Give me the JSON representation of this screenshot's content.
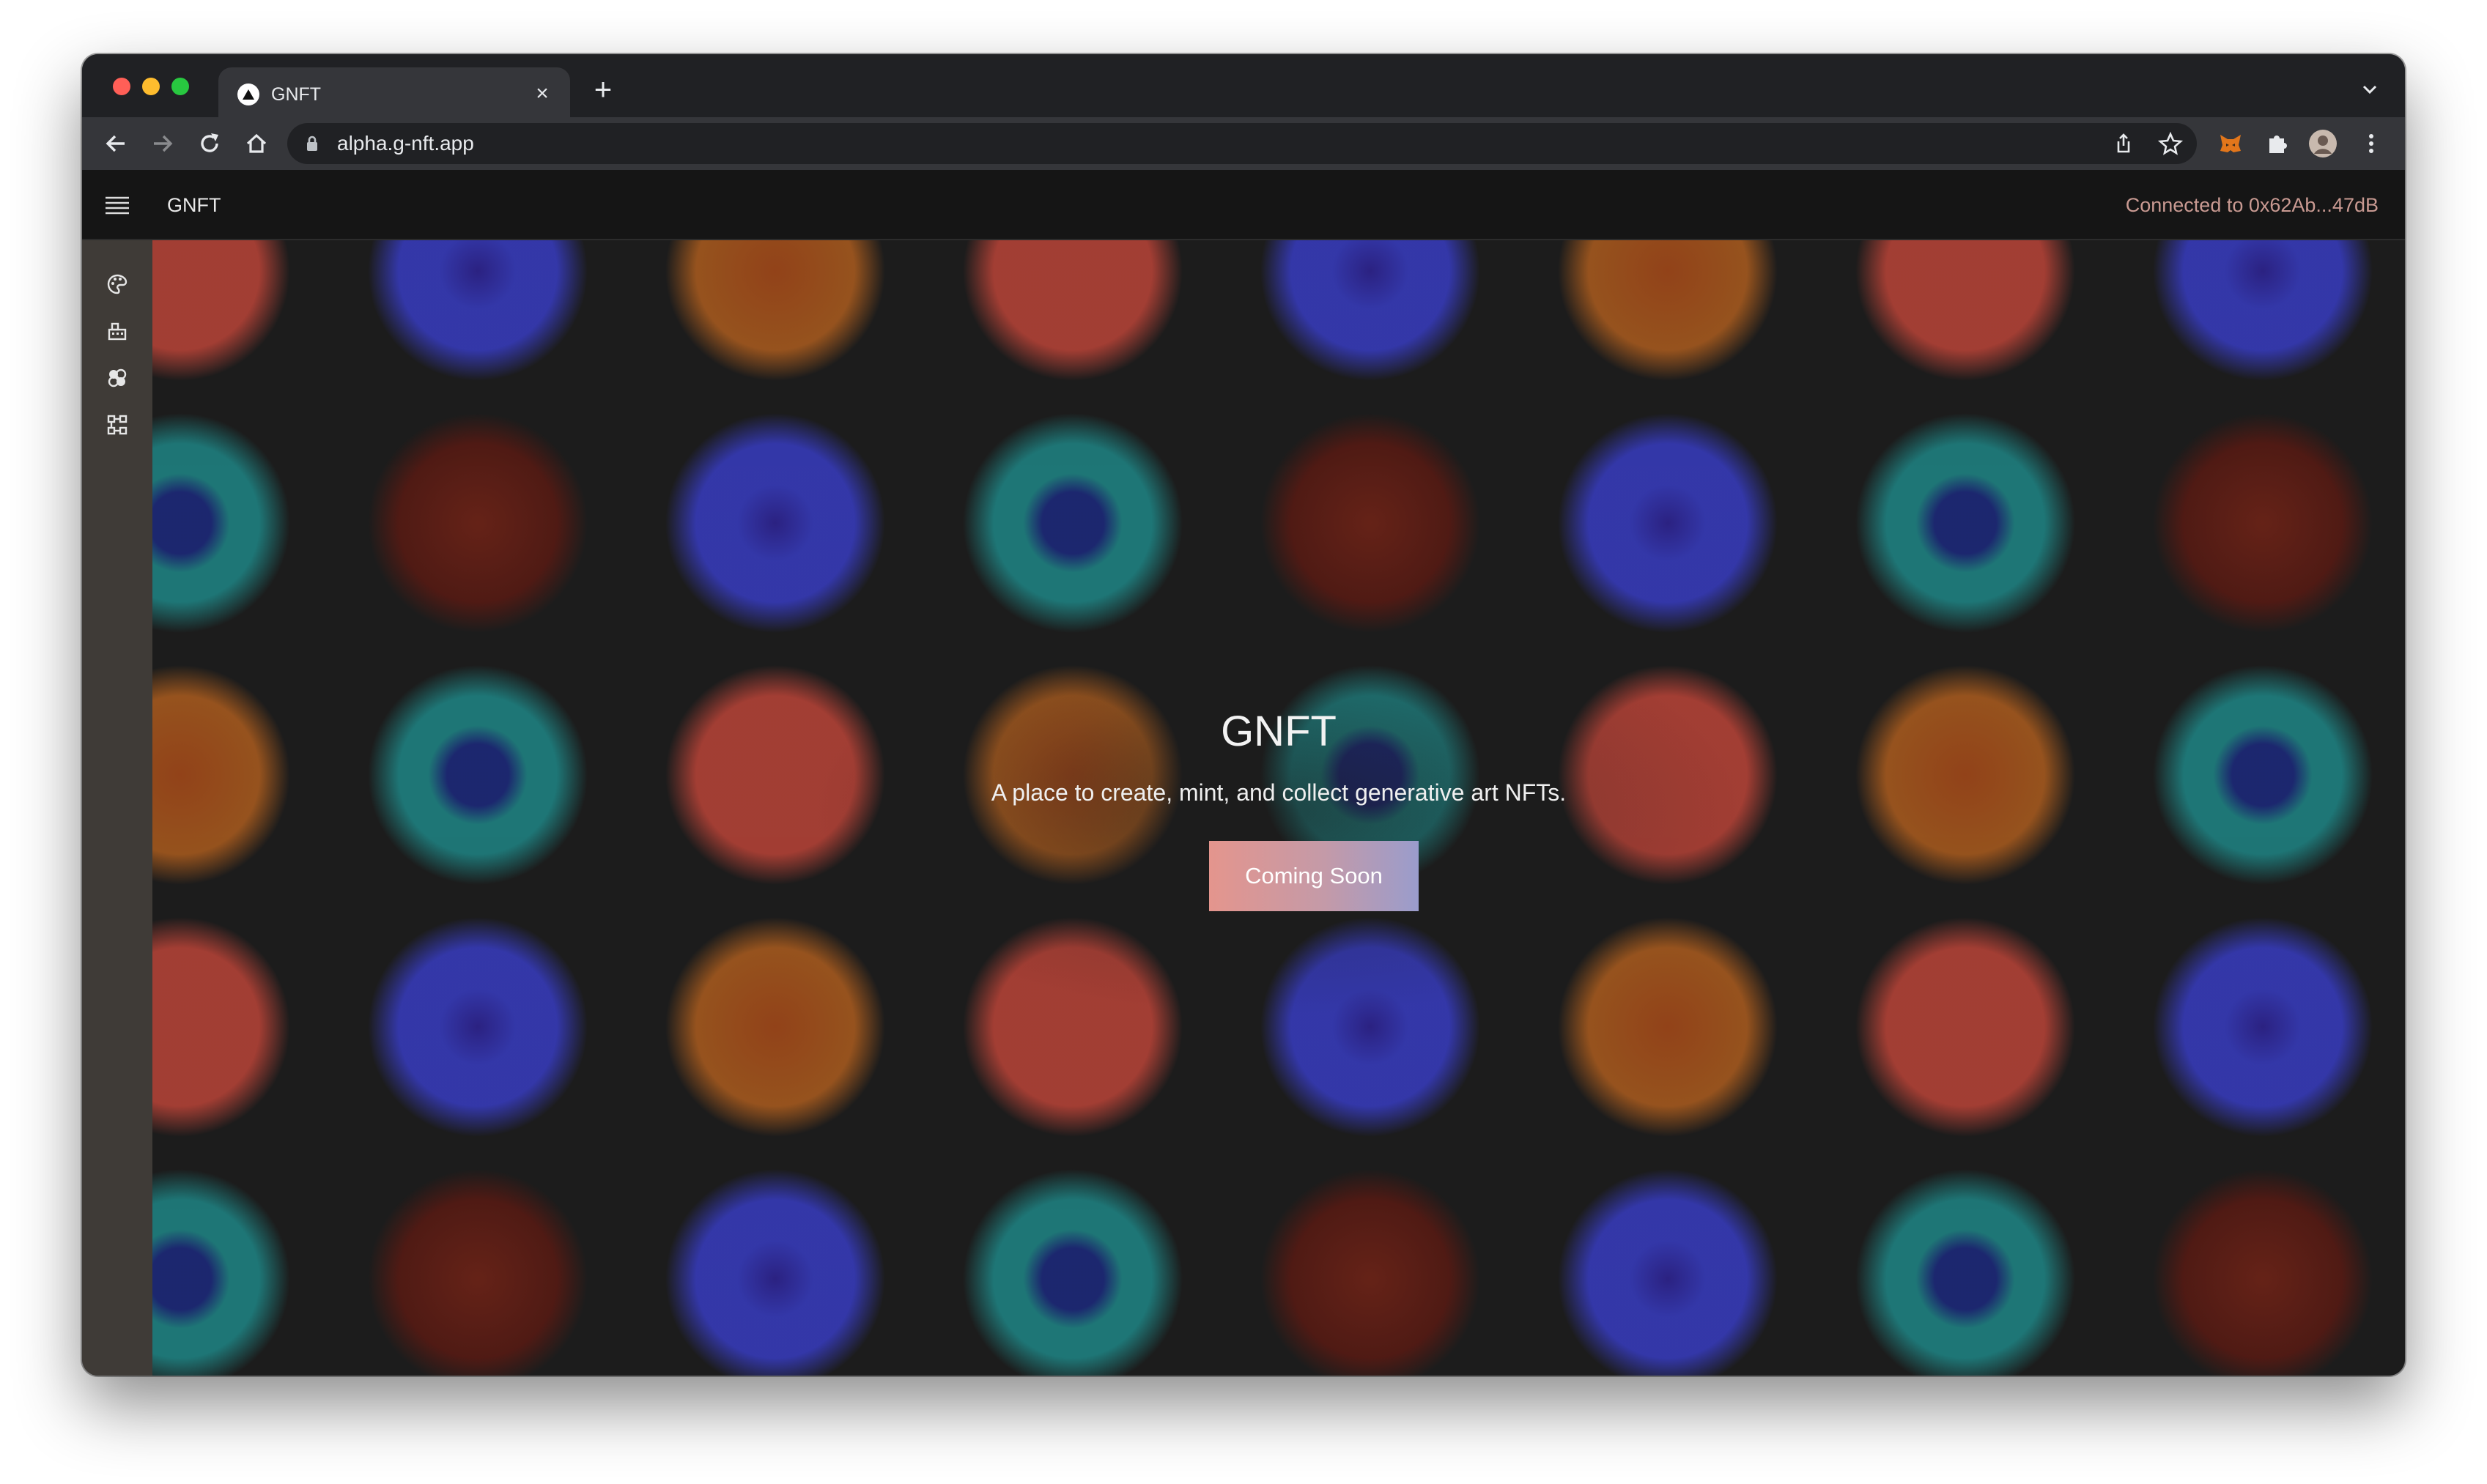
{
  "browser": {
    "tab_title": "GNFT",
    "tab_close": "×",
    "new_tab": "+",
    "url": "alpha.g-nft.app"
  },
  "app": {
    "name": "GNFT",
    "wallet_status": "Connected to 0x62Ab...47dB"
  },
  "hero": {
    "title": "GNFT",
    "subtitle": "A place to create, mint, and collect generative art NFTs.",
    "button_label": "Coming Soon"
  },
  "siderail": {
    "icons": [
      "palette-icon",
      "factory-icon",
      "collection-icon",
      "network-icon"
    ]
  },
  "colors": {
    "background": "#1c1c1c",
    "rail": "#3f3b37",
    "header": "#151515",
    "wallet_text": "#c99a92",
    "cta_gradient": [
      "#e4958d",
      "#9a9ccc"
    ],
    "orb_red": "#c8473a",
    "orb_blue": "#3a3fd0",
    "orb_orange": "#b8621e",
    "orb_teal": "#1f8f8f",
    "orb_maroon": "#6a1c14"
  }
}
